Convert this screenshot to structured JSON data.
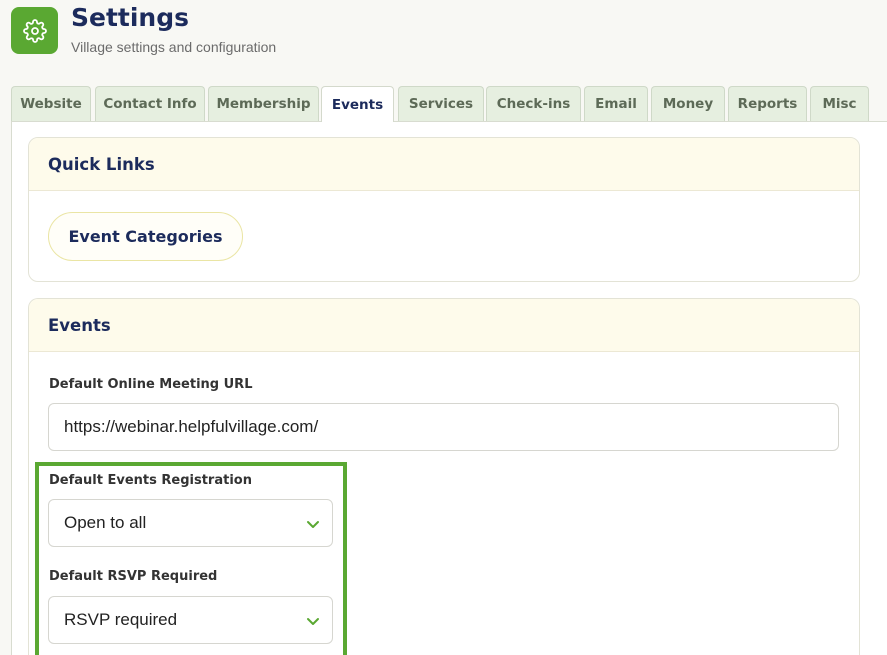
{
  "header": {
    "title": "Settings",
    "subtitle": "Village settings and configuration",
    "icon": "gear-icon",
    "accent_color": "#5aa832"
  },
  "tabs": [
    {
      "label": "Website",
      "active": false
    },
    {
      "label": "Contact Info",
      "active": false
    },
    {
      "label": "Membership",
      "active": false
    },
    {
      "label": "Events",
      "active": true
    },
    {
      "label": "Services",
      "active": false
    },
    {
      "label": "Check-ins",
      "active": false
    },
    {
      "label": "Email",
      "active": false
    },
    {
      "label": "Money",
      "active": false
    },
    {
      "label": "Reports",
      "active": false
    },
    {
      "label": "Misc",
      "active": false
    }
  ],
  "quick_links": {
    "title": "Quick Links",
    "button_label": "Event Categories"
  },
  "events": {
    "title": "Events",
    "meeting_url_label": "Default Online Meeting URL",
    "meeting_url_value": "https://webinar.helpfulvillage.com/",
    "registration_label": "Default Events Registration",
    "registration_value": "Open to all",
    "rsvp_label": "Default RSVP Required",
    "rsvp_value": "RSVP required"
  }
}
